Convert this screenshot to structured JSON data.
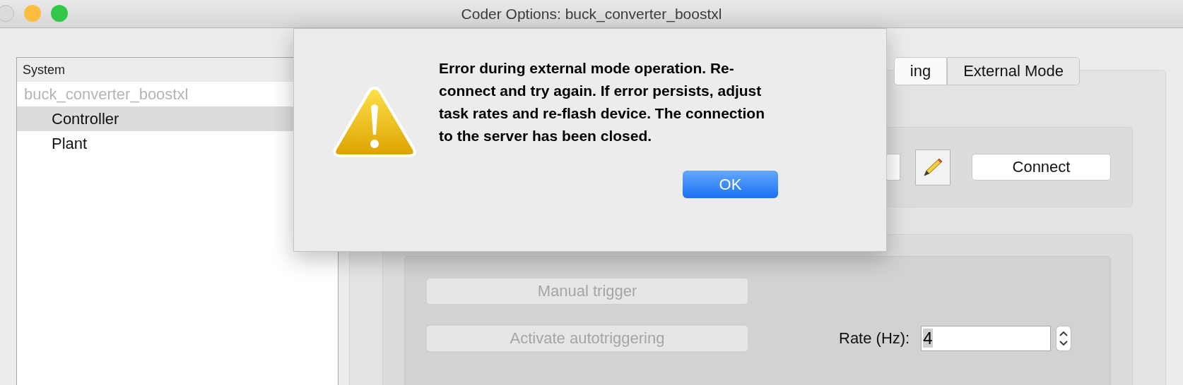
{
  "window": {
    "title": "Coder Options: buck_converter_boostxl"
  },
  "tree": {
    "header": "System",
    "root": {
      "label": "buck_converter_boostxl",
      "disabled": true,
      "children": [
        {
          "label": "Controller",
          "selected": true
        },
        {
          "label": "Plant",
          "selected": false
        }
      ]
    }
  },
  "tabs": [
    {
      "label": "ing",
      "selected": true
    },
    {
      "label": "External Mode",
      "selected": false
    }
  ],
  "connection": {
    "connect_button": "Connect"
  },
  "triggering": {
    "manual_button": {
      "label": "Manual trigger",
      "disabled": true
    },
    "auto_button": {
      "label": "Activate autotriggering",
      "disabled": true
    },
    "rate": {
      "label": "Rate (Hz):",
      "value": "4"
    }
  },
  "dialog": {
    "message": "Error during external mode operation. Re-connect and try again. If error persists, adjust task rates and re-flash device. The connection to the server has been closed.",
    "ok_button": "OK"
  }
}
